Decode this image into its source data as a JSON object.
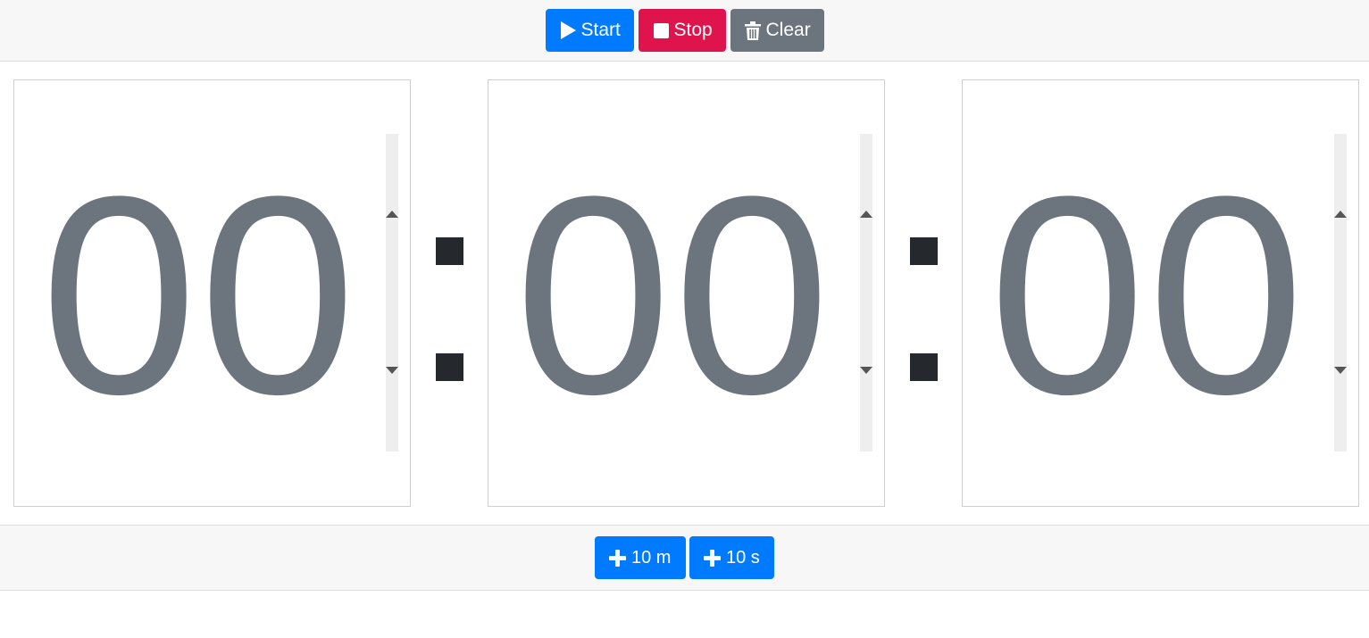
{
  "toolbar": {
    "start_label": "Start",
    "stop_label": "Stop",
    "clear_label": "Clear",
    "colors": {
      "start": "#007bff",
      "stop": "#e0144c",
      "clear": "#6c757d"
    }
  },
  "timer": {
    "hours": "00",
    "minutes": "00",
    "seconds": "00",
    "digit_color": "#6c757d"
  },
  "quick_add": {
    "minutes_label": "10 m",
    "seconds_label": "10 s"
  },
  "icons": {
    "start": "play-icon",
    "stop": "stop-icon",
    "clear": "trash-icon",
    "add": "plus-icon",
    "spin_up": "caret-up-icon",
    "spin_down": "caret-down-icon"
  }
}
